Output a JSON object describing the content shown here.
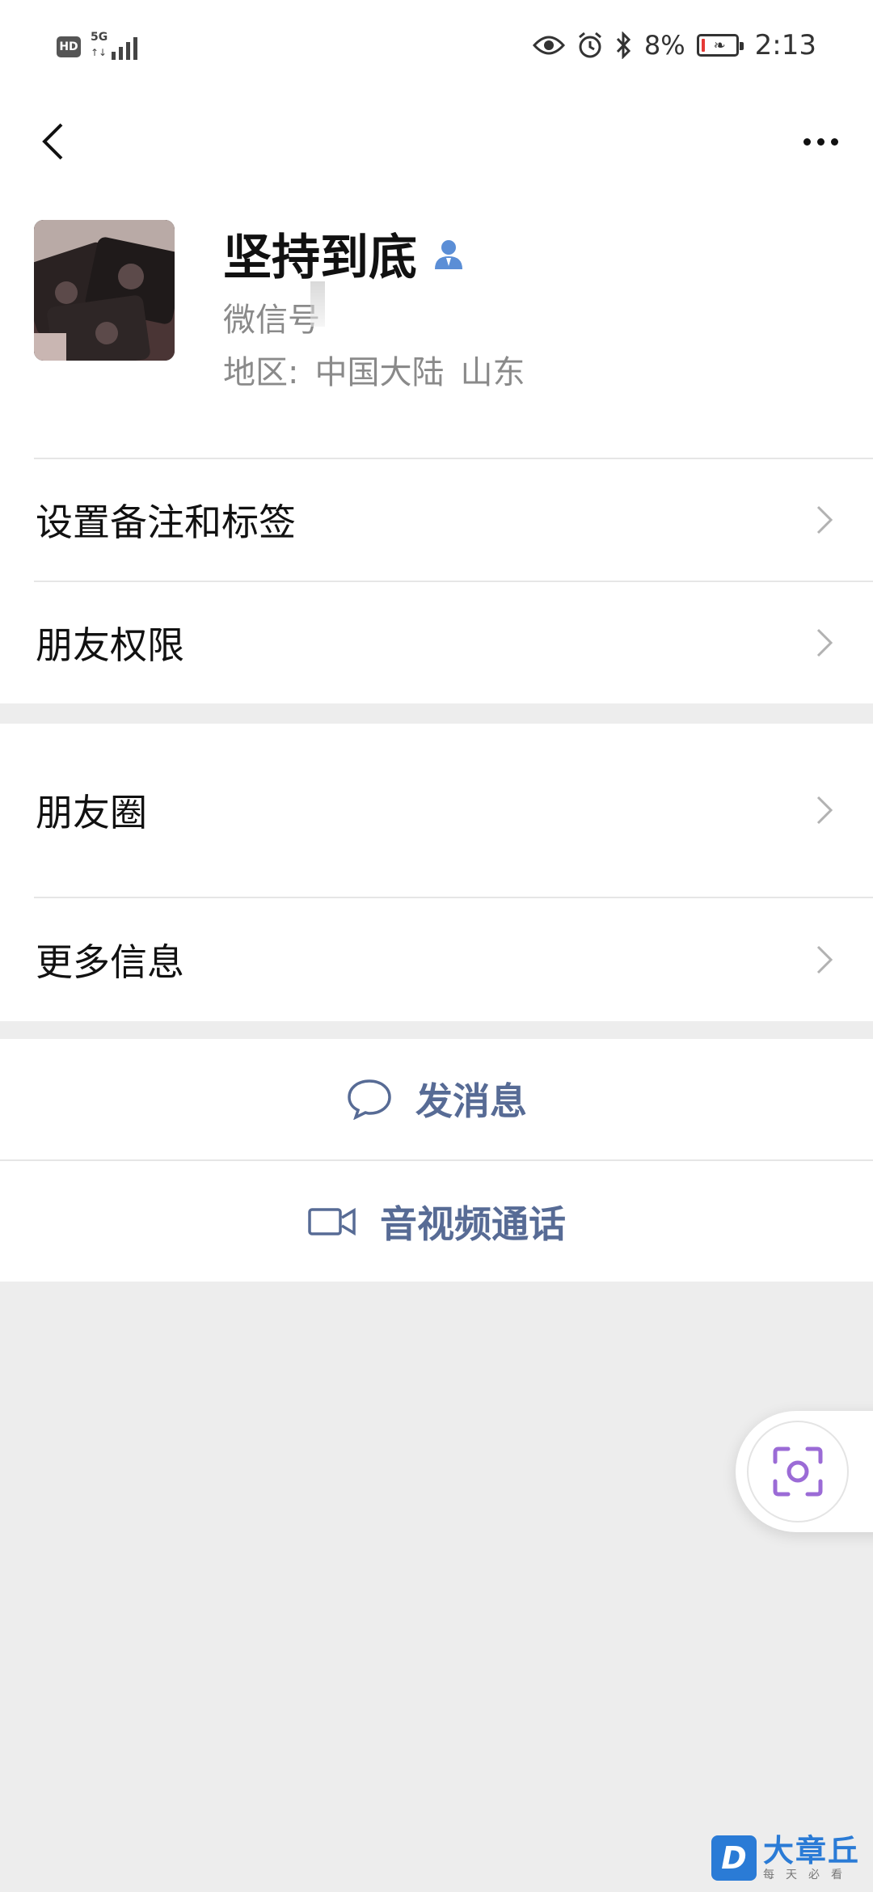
{
  "status_bar": {
    "hd": "HD",
    "network": "5G",
    "battery_pct": "8%",
    "time": "2:13",
    "icons": [
      "eye-icon",
      "alarm-icon",
      "bluetooth-icon",
      "battery-icon"
    ],
    "battery_level": 0.08,
    "battery_color": "#e53935"
  },
  "nav": {
    "back_icon": "chevron-left-icon",
    "more_icon": "more-dots-icon"
  },
  "profile": {
    "nickname": "坚持到底",
    "contact_icon": "person-icon",
    "wechat_id_label": "微信号",
    "region_label": "地区:",
    "region_country": "中国大陆",
    "region_province": "山东"
  },
  "menu": {
    "items": [
      {
        "label": "设置备注和标签"
      },
      {
        "label": "朋友权限"
      },
      {
        "label": "朋友圈"
      },
      {
        "label": "更多信息"
      }
    ]
  },
  "actions": {
    "message": "发消息",
    "call": "音视频通话"
  },
  "watermark": {
    "logo_letter": "D",
    "title": "大章丘",
    "subtitle": "每天必看"
  },
  "colors": {
    "link_blue": "#576b95",
    "background": "#ededed",
    "scan_purple": "#9b6bd6"
  }
}
